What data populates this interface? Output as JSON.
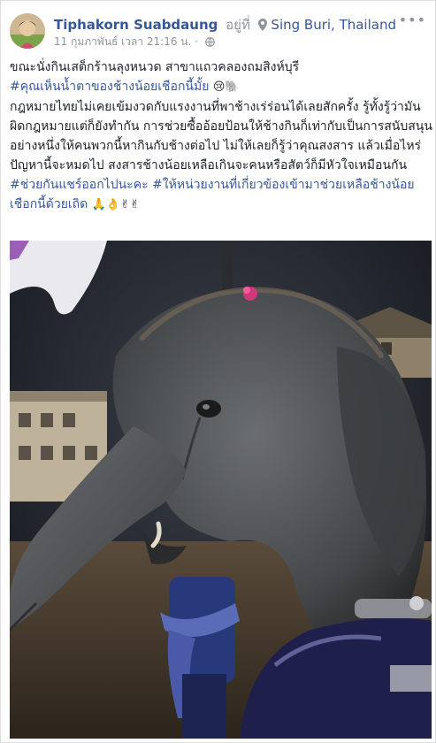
{
  "post": {
    "author": "Tiphakorn Suabdaung",
    "at_text": "อยู่ที่",
    "location": "Sing Buri, Thailand",
    "timestamp": "11 กุมภาพันธ์ เวลา 21:16 น.",
    "separator": "·",
    "more_label": "•••",
    "icons": {
      "pin": "map-pin-icon",
      "audience": "globe-icon",
      "avatar": "profile-avatar",
      "emoji_1": "crying-face-icon",
      "emoji_2": "elephant-icon",
      "emoji_3": "folded-hands-icon",
      "emoji_4": "ok-hand-icon",
      "emoji_5": "victory-hand-icon"
    },
    "text": {
      "line1": "ขณะนั่งกินเสต็กร้านลุงหนวด สาขาแถวคลองถมสิงห์บุรี",
      "hashtag1": "#คุณเห็นน้ำตาของช้างน้อยเชือกนี้มั้ย",
      "emoji_after_hashtag1": "😢🐘",
      "paragraph": "กฎหมายไทยไม่เคยเข้มงวดกับแรงงานที่พาช้างเร่ร่อนได้เลยสักครั้ง รู้ทั้งรู้ว่ามันผิดกฎหมายแต่ก็ยังทำกัน การช่วยซื้ออ้อยป้อนให้ช้างกินก็เท่ากับเป็นการสนับสนุนอย่างหนึ่งให้คนพวกนี้หากินกับช้างต่อไป ไม่ให้เลยก็รู้ว่าคุณสงสาร แล้วเมื่อไหร่ปัญหานี้จะหมดไป สงสารช้างน้อยเหลือเกินจะคนหรือสัตว์ก็มีหัวใจเหมือนกัน",
      "hashtag2": "#ช่วยกันแชร์ออกไปนะคะ",
      "hashtag3": "#ให้หน่วยงานที่เกี่ยวข้องเข้ามาช่วยเหลือช้างน้อยเชือกนี้ด้วยเถิด",
      "emoji_end": "🙏👌✌✌"
    }
  },
  "colors": {
    "link": "#365899",
    "text": "#1d2129",
    "meta": "#90949c",
    "border": "#dddfe2"
  }
}
